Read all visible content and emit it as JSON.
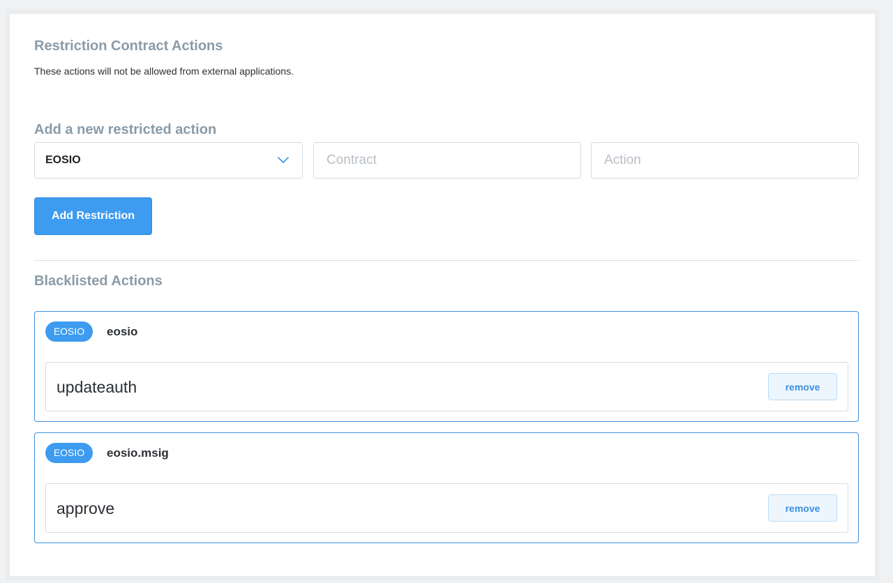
{
  "header": {
    "title": "Restriction Contract Actions",
    "subtitle": "These actions will not be allowed from external applications."
  },
  "add_section": {
    "title": "Add a new restricted action",
    "blockchain_select": {
      "value": "EOSIO"
    },
    "contract_input": {
      "placeholder": "Contract",
      "value": ""
    },
    "action_input": {
      "placeholder": "Action",
      "value": ""
    },
    "submit_label": "Add Restriction"
  },
  "blacklist": {
    "title": "Blacklisted Actions",
    "groups": [
      {
        "badge": "EOSIO",
        "contract": "eosio",
        "actions": [
          {
            "name": "updateauth",
            "remove_label": "remove"
          }
        ]
      },
      {
        "badge": "EOSIO",
        "contract": "eosio.msig",
        "actions": [
          {
            "name": "approve",
            "remove_label": "remove"
          }
        ]
      }
    ]
  },
  "colors": {
    "accent": "#3d9bf0",
    "heading": "#8a9ba8",
    "card_border": "#3d8fe0"
  },
  "icons": {
    "select_arrow": "chevron-down-icon"
  }
}
